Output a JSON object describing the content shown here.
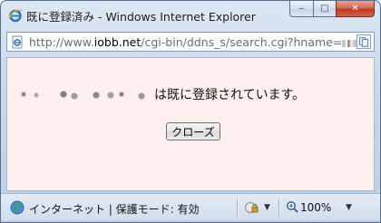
{
  "window": {
    "title": "既に登録済み - Windows Internet Explorer",
    "min_glyph": "‒",
    "max_glyph": "□",
    "close_glyph": "✕"
  },
  "address": {
    "url_prefix": "http://www.",
    "url_host": "iobb.net",
    "url_rest": "/cgi-bin/ddns_s/search.cgi?hname="
  },
  "content": {
    "message": "は既に登録されています。",
    "close_button_label": "クローズ",
    "background_color": "#fff0f0"
  },
  "statusbar": {
    "zone_text": "インターネット | 保護モード: 有効",
    "zoom_level": "100%",
    "dropdown_glyph": "▼"
  },
  "icons": {
    "title": "ie-logo-icon",
    "address": "page-icon",
    "page_tool": "compatibility-view-icon",
    "zone": "globe-icon",
    "security": "lock-icon",
    "zoom": "magnifier-icon"
  }
}
